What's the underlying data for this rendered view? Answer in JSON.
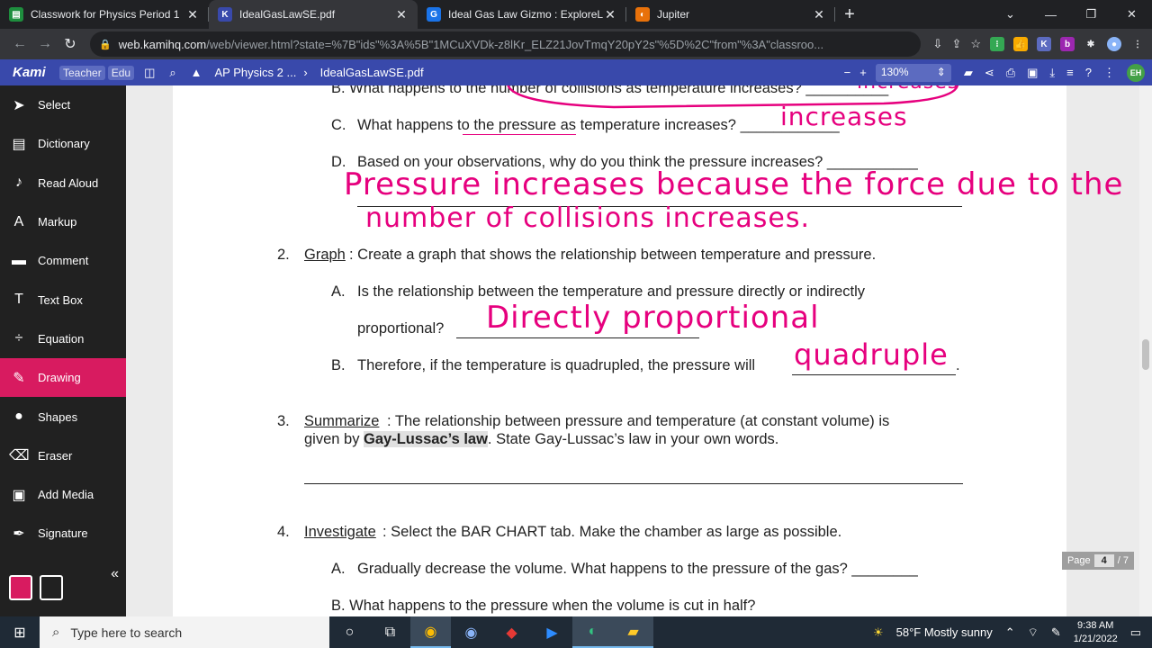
{
  "browser": {
    "tabs": [
      {
        "title": "Classwork for Physics Period 1",
        "favicon": "google-classroom-icon",
        "color": "#1e8e3e",
        "glyph": "▤",
        "active": false
      },
      {
        "title": "IdealGasLawSE.pdf",
        "favicon": "kami-icon",
        "color": "#3949ab",
        "glyph": "K",
        "active": true
      },
      {
        "title": "Ideal Gas Law Gizmo : ExploreLe",
        "favicon": "gizmos-icon",
        "color": "#1a73e8",
        "glyph": "G",
        "active": false
      },
      {
        "title": "Jupiter",
        "favicon": "jupiter-icon",
        "color": "#e8710a",
        "glyph": "◐",
        "active": false
      }
    ],
    "url_host": "web.kamihq.com",
    "url_rest": "/web/viewer.html?state=%7B\"ids\"%3A%5B\"1MCuXVDk-z8lKr_ELZ21JovTmqY20pY2s\"%5D%2C\"from\"%3A\"classroo..."
  },
  "kami": {
    "logo": "Kami",
    "badge_teacher": "Teacher",
    "badge_edu": "Edu",
    "drive_path": "AP Physics 2 ...",
    "file_name": "IdealGasLawSE.pdf",
    "zoom_level": "130%",
    "user_initials": "EH"
  },
  "tools": [
    {
      "label": "Select",
      "icon": "cursor-icon",
      "glyph": "➤",
      "active": false
    },
    {
      "label": "Dictionary",
      "icon": "book-icon",
      "glyph": "▤",
      "active": false
    },
    {
      "label": "Read Aloud",
      "icon": "speaker-icon",
      "glyph": "♪",
      "active": false
    },
    {
      "label": "Markup",
      "icon": "highlighter-icon",
      "glyph": "A",
      "active": false
    },
    {
      "label": "Comment",
      "icon": "comment-icon",
      "glyph": "▬",
      "active": false
    },
    {
      "label": "Text Box",
      "icon": "text-icon",
      "glyph": "T",
      "active": false
    },
    {
      "label": "Equation",
      "icon": "divide-icon",
      "glyph": "÷",
      "active": false
    },
    {
      "label": "Drawing",
      "icon": "brush-icon",
      "glyph": "✎",
      "active": true
    },
    {
      "label": "Shapes",
      "icon": "shapes-icon",
      "glyph": "●",
      "active": false
    },
    {
      "label": "Eraser",
      "icon": "eraser-icon",
      "glyph": "⌫",
      "active": false
    },
    {
      "label": "Add Media",
      "icon": "media-icon",
      "glyph": "▣",
      "active": false
    },
    {
      "label": "Signature",
      "icon": "signature-icon",
      "glyph": "✒",
      "active": false
    }
  ],
  "drawing": {
    "stroke_width": "2",
    "colors": [
      "#ff1493",
      "#f5f500",
      "#000000"
    ]
  },
  "document": {
    "q1b": "B.   What happens to the number of collisions as temperature increases? __________",
    "q1c_label": "C.",
    "q1c": "What happens to the pressure as temperature increases? ____________",
    "q1d_label": "D.",
    "q1d": "Based on your observations, why do you think the pressure increases? ___________",
    "q2_num": "2.",
    "q2_term": "Graph",
    "q2": ": Create a graph that shows the relationship between temperature and pressure.",
    "q2a_label": "A.",
    "q2a_line1": "Is the relationship between the temperature and pressure directly or indirectly",
    "q2a_line2": "proportional? ",
    "q2b_label": "B.",
    "q2b": "Therefore, if the temperature is quadrupled, the pressure will ",
    "q3_num": "3.",
    "q3_term": "Summarize",
    "q3_line1": ": The relationship between pressure and temperature (at constant volume) is",
    "q3_line2a": "given by ",
    "q3_law": "Gay-Lussac’s law",
    "q3_line2b": ". State Gay-Lussac’s law in your own words.",
    "q4_num": "4.",
    "q4_term": "Investigate",
    "q4": ": Select the BAR CHART tab. Make the chamber as large as possible.",
    "q4a_label": "A.",
    "q4a": "Gradually decrease the volume. What happens to the pressure of the gas? ________",
    "q4b": "B.   What happens to the pressure when the volume is cut in half?"
  },
  "handwriting": {
    "q1b": "increases",
    "q1c": "increases",
    "q1d_line1": "Pressure increases because the force due to the",
    "q1d_line2": "number of collisions increases.",
    "q2a": "Directly proportional",
    "q2b": "quadruple"
  },
  "pager": {
    "label": "Page",
    "current": "4",
    "total": "/ 7"
  },
  "taskbar": {
    "search_placeholder": "Type here to search",
    "weather": "58°F  Mostly sunny",
    "time": "9:38 AM",
    "date": "1/21/2022"
  }
}
